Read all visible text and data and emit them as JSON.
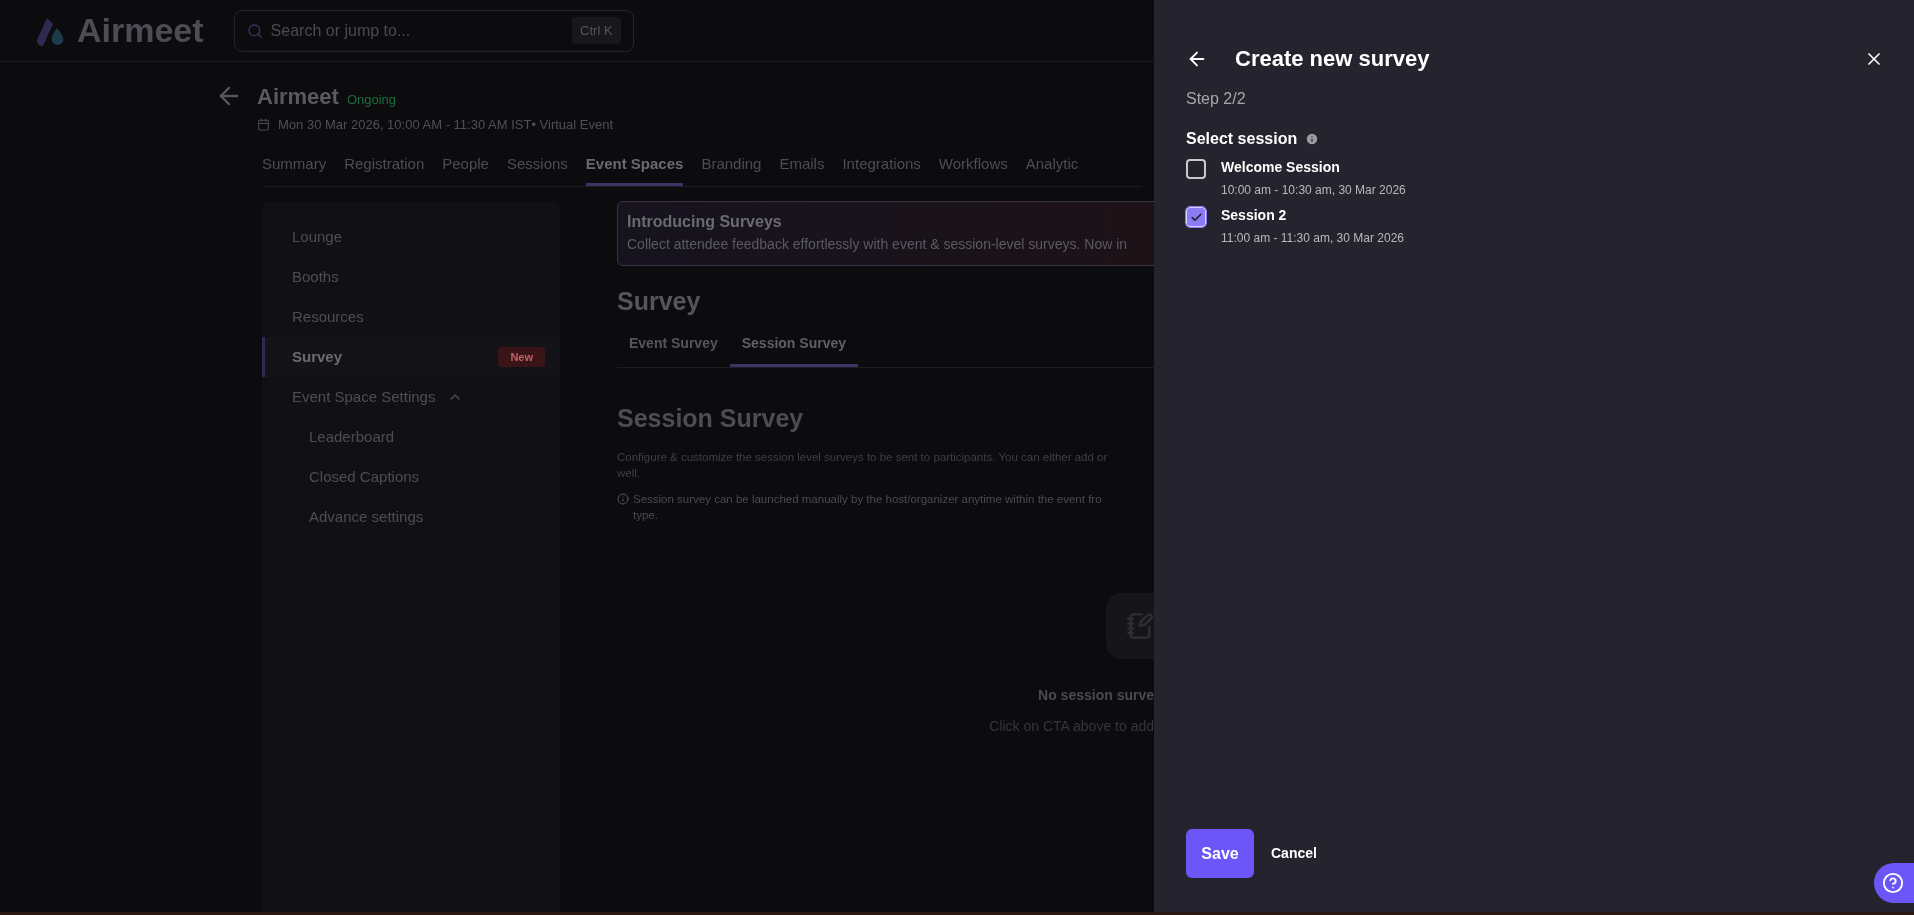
{
  "header": {
    "logo": "Airmeet",
    "search": {
      "placeholder": "Search or jump to...",
      "shortcut": "Ctrl K"
    }
  },
  "event": {
    "title": "Airmeet",
    "status": "Ongoing",
    "datetime": "Mon 30 Mar 2026, 10:00 AM - 11:30 AM IST• Virtual Event"
  },
  "tabs": [
    {
      "label": "Summary",
      "selected": false
    },
    {
      "label": "Registration",
      "selected": false
    },
    {
      "label": "People",
      "selected": false
    },
    {
      "label": "Sessions",
      "selected": false
    },
    {
      "label": "Event Spaces",
      "selected": true
    },
    {
      "label": "Branding",
      "selected": false
    },
    {
      "label": "Emails",
      "selected": false
    },
    {
      "label": "Integrations",
      "selected": false
    },
    {
      "label": "Workflows",
      "selected": false
    },
    {
      "label": "Analytic",
      "selected": false
    }
  ],
  "sidebar": {
    "items": [
      {
        "label": "Lounge",
        "selected": false
      },
      {
        "label": "Booths",
        "selected": false
      },
      {
        "label": "Resources",
        "selected": false
      },
      {
        "label": "Survey",
        "selected": true,
        "badge": "New"
      },
      {
        "label": "Event Space Settings",
        "selected": false,
        "expanded": true,
        "children": [
          {
            "label": "Leaderboard",
            "selected": false
          },
          {
            "label": "Closed Captions",
            "selected": false
          },
          {
            "label": "Advance settings",
            "selected": false
          }
        ]
      }
    ]
  },
  "banner": {
    "title": "Introducing Surveys",
    "text": "Collect attendee feedback effortlessly with event & session-level surveys. Now in"
  },
  "survey": {
    "heading": "Survey",
    "tabs": [
      {
        "label": "Event Survey",
        "selected": false
      },
      {
        "label": "Session Survey",
        "selected": true
      }
    ],
    "section_title": "Session Survey",
    "description": [
      "Configure & customize the session level surveys to be sent to participants. You can either add or",
      "well."
    ],
    "note": [
      "Session survey can be launched manually by the host/organizer anytime within the event fro",
      "type."
    ],
    "empty_state": {
      "title": "No session surve",
      "text": "Click on CTA above to add"
    }
  },
  "drawer": {
    "title": "Create new survey",
    "step": "Step 2/2",
    "label": "Select session",
    "sessions": [
      {
        "name": "Welcome Session",
        "time": "10:00 am - 10:30 am, 30 Mar 2026",
        "checked": false
      },
      {
        "name": "Session 2",
        "time": "11:00 am - 11:30 am, 30 Mar 2026",
        "checked": true
      }
    ],
    "save": "Save",
    "cancel": "Cancel"
  }
}
